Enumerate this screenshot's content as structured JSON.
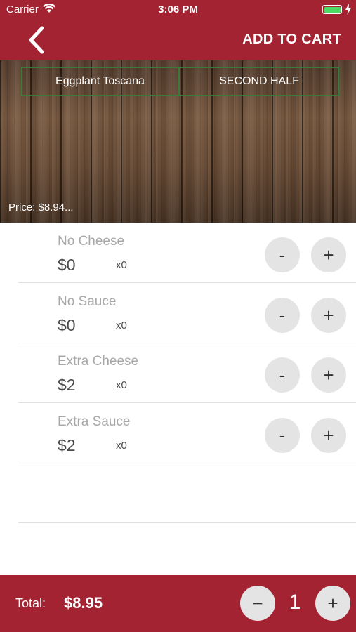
{
  "status_bar": {
    "carrier": "Carrier",
    "time": "3:06 PM"
  },
  "header": {
    "add_to_cart": "ADD TO CART"
  },
  "halves": {
    "first": "Eggplant Toscana",
    "second": "SECOND HALF"
  },
  "price_label": "Price: $8.94...",
  "options": [
    {
      "name": "No Cheese",
      "price": "$0",
      "qty": "x0",
      "minus": "-",
      "plus": "+"
    },
    {
      "name": "No Sauce",
      "price": "$0",
      "qty": "x0",
      "minus": "-",
      "plus": "+"
    },
    {
      "name": "Extra Cheese",
      "price": "$2",
      "qty": "x0",
      "minus": "-",
      "plus": "+"
    },
    {
      "name": "Extra Sauce",
      "price": "$2",
      "qty": "x0",
      "minus": "-",
      "plus": "+"
    }
  ],
  "footer": {
    "total_label": "Total:",
    "total_value": "$8.95",
    "quantity": "1",
    "minus": "−",
    "plus": "+"
  },
  "colors": {
    "primary": "#a32332",
    "button_bg": "#e4e4e4",
    "battery": "#4cd964",
    "tab_border": "#3c7a3c"
  }
}
